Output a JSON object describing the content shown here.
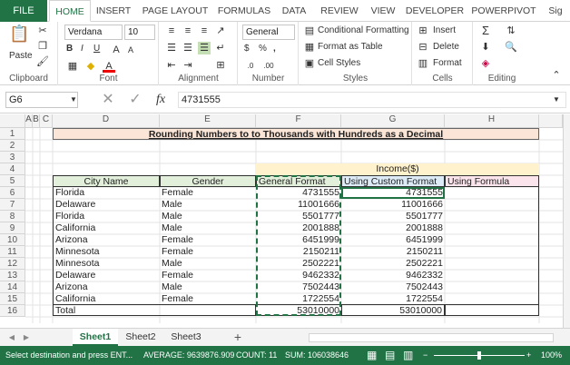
{
  "tabs": {
    "file": "FILE",
    "items": [
      "HOME",
      "INSERT",
      "PAGE LAYOUT",
      "FORMULAS",
      "DATA",
      "REVIEW",
      "VIEW",
      "DEVELOPER",
      "POWERPIVOT",
      "Sig"
    ]
  },
  "ribbon": {
    "clipboard": {
      "paste": "Paste",
      "label": "Clipboard"
    },
    "font": {
      "name": "Verdana",
      "size": "10",
      "label": "Font",
      "bold": "B",
      "italic": "I",
      "underline": "U"
    },
    "alignment": {
      "label": "Alignment"
    },
    "number": {
      "format": "General",
      "label": "Number",
      "currency": "$",
      "percent": "%",
      "comma": ","
    },
    "styles": {
      "conditional": "Conditional Formatting",
      "table": "Format as Table",
      "cell": "Cell Styles",
      "label": "Styles"
    },
    "cells": {
      "insert": "Insert",
      "delete": "Delete",
      "format": "Format",
      "label": "Cells"
    },
    "editing": {
      "label": "Editing"
    }
  },
  "formula_bar": {
    "name_box": "G6",
    "fx": "fx",
    "value": "4731555"
  },
  "columns": [
    "A",
    "B",
    "C",
    "D",
    "E",
    "F",
    "G",
    "H"
  ],
  "rows": [
    "1",
    "2",
    "3",
    "4",
    "5",
    "6",
    "7",
    "8",
    "9",
    "10",
    "11",
    "12",
    "13",
    "14",
    "15",
    "16"
  ],
  "sheet": {
    "title": "Rounding Numbers to to Thousands with Hundreds as a Decimal",
    "income_header": "Income($)",
    "headers": [
      "City Name",
      "Gender",
      "General Format",
      "Using Custom Format",
      "Using Formula"
    ],
    "data": [
      [
        "Florida",
        "Female",
        "4731555",
        "4731555"
      ],
      [
        "Delaware",
        "Male",
        "11001666",
        "11001666"
      ],
      [
        "Florida",
        "Male",
        "5501777",
        "5501777"
      ],
      [
        "California",
        "Male",
        "2001888",
        "2001888"
      ],
      [
        "Arizona",
        "Female",
        "6451999",
        "6451999"
      ],
      [
        "Minnesota",
        "Female",
        "2150211",
        "2150211"
      ],
      [
        "Minnesota",
        "Male",
        "2502221",
        "2502221"
      ],
      [
        "Delaware",
        "Female",
        "9462332",
        "9462332"
      ],
      [
        "Arizona",
        "Male",
        "7502443",
        "7502443"
      ],
      [
        "California",
        "Female",
        "1722554",
        "1722554"
      ]
    ],
    "total": [
      "Total",
      "53010000",
      "53010000"
    ]
  },
  "sheet_tabs": [
    "Sheet1",
    "Sheet2",
    "Sheet3"
  ],
  "add_sheet": "+",
  "status": {
    "message": "Select destination and press ENT...",
    "average": "AVERAGE: 9639876.909",
    "count": "COUNT: 11",
    "sum": "SUM: 106038646",
    "zoom": "100%"
  },
  "colors": {
    "accent": "#217346",
    "title_fill": "#fbe5d6",
    "income_fill": "#fff2cc",
    "header_d_fill": "#e2efda",
    "header_g_fill": "#ddebf7",
    "header_h_fill": "#fce4ec"
  }
}
